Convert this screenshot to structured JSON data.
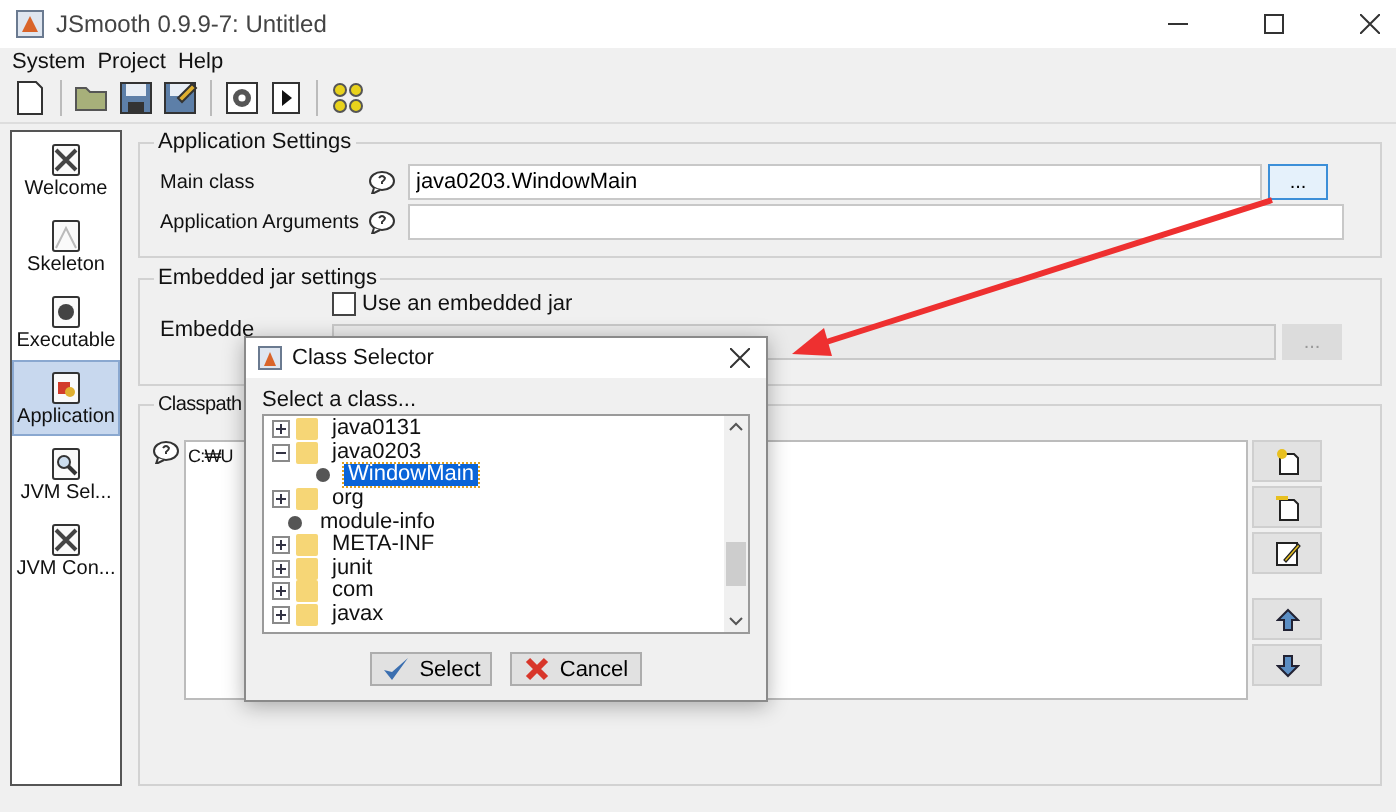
{
  "window": {
    "title": "JSmooth 0.9.9-7: Untitled"
  },
  "menu": [
    "System",
    "Project",
    "Help"
  ],
  "sidebar": {
    "items": [
      {
        "label": "Welcome",
        "kind": "welcome",
        "selected": false
      },
      {
        "label": "Skeleton",
        "kind": "skeleton",
        "selected": false
      },
      {
        "label": "Executable",
        "kind": "executable",
        "selected": false
      },
      {
        "label": "Application",
        "kind": "application",
        "selected": true
      },
      {
        "label": "JVM Sel...",
        "kind": "jvm-select",
        "selected": false
      },
      {
        "label": "JVM Con...",
        "kind": "jvm-config",
        "selected": false
      }
    ]
  },
  "application_settings": {
    "title": "Application Settings",
    "main_class": {
      "label": "Main class",
      "value": "java0203.WindowMain",
      "button": "...",
      "disabled": false
    },
    "arguments": {
      "label": "Application Arguments"
    }
  },
  "embedded_jar": {
    "title": "Embedded jar settings",
    "label": "Embedde",
    "checkbox": {
      "label": "Use an embedded jar",
      "checked": false
    },
    "button": "...",
    "disabled": true
  },
  "classpath": {
    "title": "Classpath",
    "items": [
      "C:₩U"
    ]
  },
  "dialog": {
    "title": "Class Selector",
    "prompt": "Select a class...",
    "tree": [
      {
        "label": "java0131",
        "kind": "package",
        "expanded": false,
        "selected": false
      },
      {
        "label": "java0203",
        "kind": "package",
        "expanded": true,
        "selected": false,
        "children": [
          {
            "label": "WindowMain",
            "kind": "class",
            "selected": true
          }
        ]
      },
      {
        "label": "org",
        "kind": "package",
        "expanded": false,
        "selected": false
      },
      {
        "label": "module-info",
        "kind": "class",
        "selected": false
      },
      {
        "label": "META-INF",
        "kind": "package",
        "expanded": false,
        "selected": false
      },
      {
        "label": "junit",
        "kind": "package",
        "expanded": false,
        "selected": false
      },
      {
        "label": "com",
        "kind": "package",
        "expanded": false,
        "selected": false
      },
      {
        "label": "javax",
        "kind": "package",
        "expanded": false,
        "selected": false
      }
    ],
    "buttons": [
      {
        "label": "Select",
        "kind": "ok"
      },
      {
        "label": "Cancel",
        "kind": "cancel"
      }
    ]
  }
}
